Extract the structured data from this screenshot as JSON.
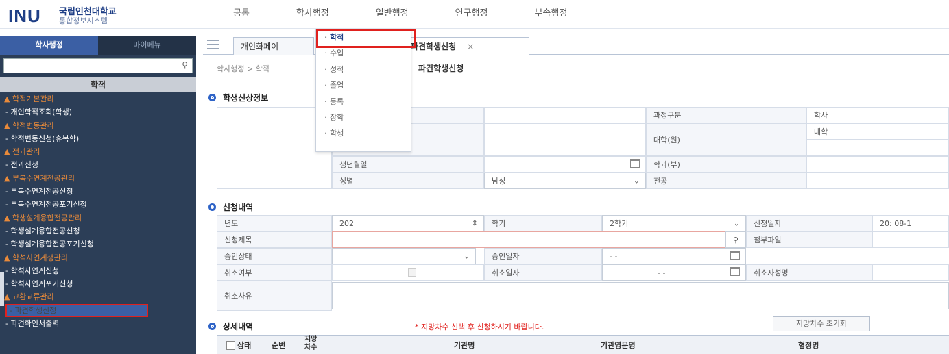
{
  "header": {
    "logo_mark": "INU",
    "logo_line1": "국립인천대학교",
    "logo_line2": "통합정보시스템",
    "menu": [
      "공통",
      "학사행정",
      "일반행정",
      "연구행정",
      "부속행정"
    ]
  },
  "sidebar": {
    "tabs": [
      "학사행정",
      "마이메뉴"
    ],
    "title": "학적",
    "items": [
      {
        "label": "▲ 학적기본관리",
        "type": "cat"
      },
      {
        "label": "- 개인학적조회(학생)",
        "type": "sub"
      },
      {
        "label": "▲ 학적변동관리",
        "type": "cat"
      },
      {
        "label": "- 학적변동신청(휴복학)",
        "type": "sub"
      },
      {
        "label": "▲ 전과관리",
        "type": "cat"
      },
      {
        "label": "- 전과신청",
        "type": "sub"
      },
      {
        "label": "▲ 부복수연계전공관리",
        "type": "cat"
      },
      {
        "label": "- 부복수연계전공신청",
        "type": "sub"
      },
      {
        "label": "- 부복수연계전공포기신청",
        "type": "sub"
      },
      {
        "label": "▲ 학생설계융합전공관리",
        "type": "cat"
      },
      {
        "label": "- 학생설계융합전공신청",
        "type": "sub"
      },
      {
        "label": "- 학생설계융합전공포기신청",
        "type": "sub"
      },
      {
        "label": "▲ 학석사연계생관리",
        "type": "cat"
      },
      {
        "label": "- 학석사연계신청",
        "type": "sub"
      },
      {
        "label": "- 학석사연계포기신청",
        "type": "sub"
      },
      {
        "label": "▲ 교환교류관리",
        "type": "cat"
      },
      {
        "label": "- 파견학생신청",
        "type": "selected"
      },
      {
        "label": "- 파견확인서출력",
        "type": "sub"
      }
    ]
  },
  "tabs": {
    "first": "개인화페이",
    "active": "파견학생신청",
    "close": "×"
  },
  "breadcrumb": "학사행정 > 학적",
  "page_title": "파견학생신청",
  "dropdown": {
    "items": [
      "학적",
      "수업",
      "성적",
      "졸업",
      "등록",
      "장학",
      "학생"
    ],
    "active_index": 0
  },
  "applicant": {
    "section_title": "학생신상정보",
    "labels": {
      "birth": "생년월일",
      "gender": "성별",
      "course": "과정구분",
      "college": "대학(원)",
      "dept": "학과(부)",
      "major": "전공"
    },
    "values": {
      "gender": "남성",
      "course": "학사",
      "college": "대학"
    }
  },
  "application": {
    "section_title": "신청내역",
    "labels": {
      "year": "년도",
      "term": "학기",
      "apply_date": "신청일자",
      "title": "신청제목",
      "attachment": "첨부파일",
      "approval_status": "승인상태",
      "approval_date": "승인일자",
      "cancel_yn": "취소여부",
      "cancel_date": "취소일자",
      "cancel_person": "취소자성명",
      "cancel_reason": "취소사유"
    },
    "values": {
      "year": "202",
      "term": "2학기",
      "apply_date": "20:   08-1",
      "approval_date": "- -",
      "cancel_date": "- -"
    }
  },
  "detail": {
    "section_title": "상세내역",
    "notice": "* 지망차수 선택 후 신청하시기 바랍니다.",
    "reset_button": "지망차수 초기화",
    "columns": [
      "상태",
      "순번",
      "지망\n차수",
      "기관명",
      "기관영문명",
      "협정명"
    ]
  },
  "colors": {
    "accent": "#2e63c7",
    "highlight": "#e0211e",
    "sidebar_bg": "#2c3e57",
    "sidebar_cat": "#e98a3a"
  }
}
